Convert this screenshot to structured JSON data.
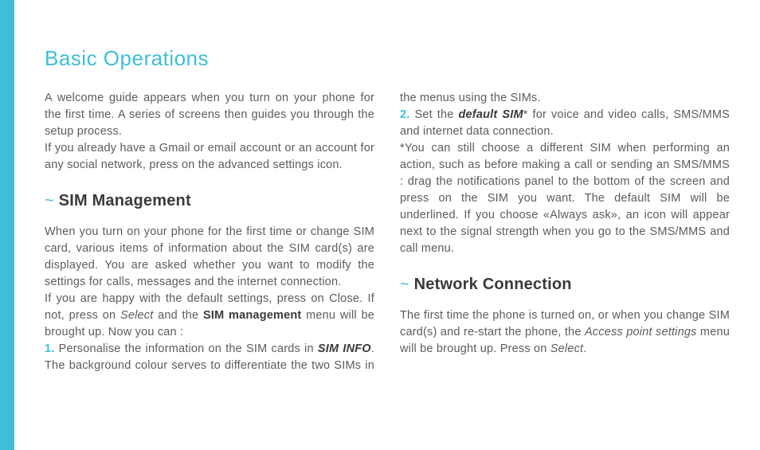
{
  "title": "Basic Operations",
  "intro_p1": "A welcome guide appears when you turn on your phone for the first time. A series of screens then guides you through the setup process.",
  "intro_p2": "If you already have a Gmail or email account or an account for any social network, press on the advanced settings icon.",
  "sim_heading": "SIM Management",
  "sim_p1": "When you turn on your phone for the first time or change SIM card, various items of information about the SIM card(s) are displayed. You are asked whether you want to modify the settings for calls, messages and the internet connection.",
  "sim_p2a": "If you are happy with the default settings, press on Close. If not, press on ",
  "sim_p2_select": "Select",
  "sim_p2b": " and the ",
  "sim_p2_mgmt": "SIM management",
  "sim_p2c": " menu will be brought up. Now you can :",
  "sim_n1": "1.",
  "sim_li1a": " Personalise the information on the SIM cards in ",
  "sim_li1b": "SIM INFO",
  "sim_li1c": ". The background colour serves to differentiate the two SIMs in the menus using the SIMs.",
  "sim_n2": "2.",
  "sim_li2a": " Set the ",
  "sim_li2b": "default SIM",
  "sim_li2c": "* for voice and video calls, SMS/MMS and internet data connection.",
  "sim_note": "*You can still choose a different SIM when performing an action, such as before making a call or sending an SMS/MMS : drag the notifications panel to the bottom of the screen and press on the SIM you want. The default SIM will be underlined. If you choose «Always ask», an icon will appear next to the signal strength when you go to the SMS/MMS and call menu.",
  "net_heading": "Network Connection",
  "net_p1a": "The first time the phone is turned on, or when you change SIM card(s) and re-start the phone, the ",
  "net_p1_aps": "Access point settings",
  "net_p1b": " menu will be brought up. Press on ",
  "net_p1_select": "Select",
  "net_p1c": ".",
  "tilde": "~"
}
